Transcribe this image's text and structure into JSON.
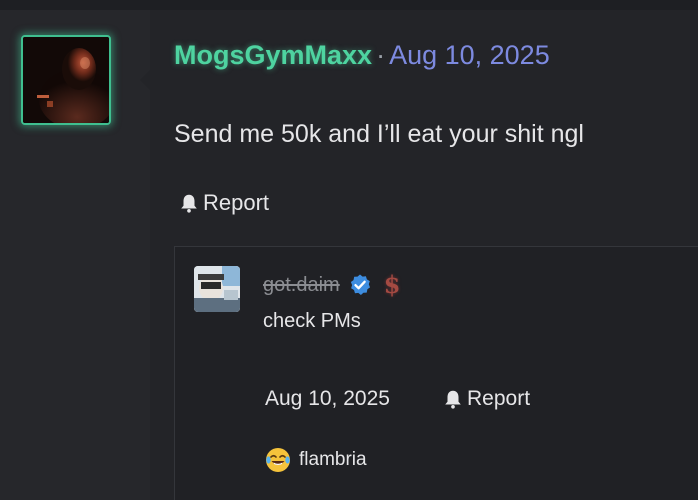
{
  "post": {
    "author": "MogsGymMaxx",
    "separator": "·",
    "date": "Aug 10, 2025",
    "text": "Send me 50k and I’ll eat your shit ngl",
    "report_label": "Report",
    "avatar_icon": "avatar-dark-figure",
    "author_color": "#4ed3a0",
    "date_color": "#7d8ae0"
  },
  "reply": {
    "author": "got.daim",
    "verified_icon": "verified-badge-icon",
    "dollar_icon": "$",
    "text": "check PMs",
    "date": "Aug 10, 2025",
    "report_label": "Report",
    "reaction": {
      "emoji_icon": "crying-laughing-face-icon",
      "user": "flambria"
    }
  }
}
